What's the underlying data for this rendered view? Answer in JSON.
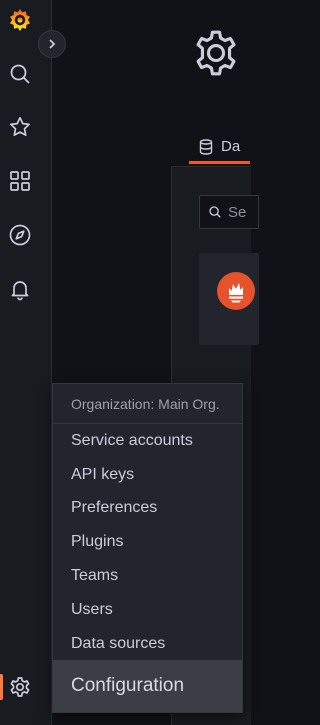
{
  "sidebar": {
    "logo_icon": "grafana-logo-icon",
    "expand_icon": "chevron-right-icon",
    "items": [
      {
        "name": "search",
        "icon": "search-icon"
      },
      {
        "name": "starred",
        "icon": "star-icon"
      },
      {
        "name": "dashboards",
        "icon": "apps-icon"
      },
      {
        "name": "explore",
        "icon": "compass-icon"
      },
      {
        "name": "alerting",
        "icon": "bell-icon"
      },
      {
        "name": "configuration",
        "icon": "gear-icon",
        "active": true
      }
    ],
    "accent_color": "#ff7941"
  },
  "page": {
    "header_icon": "gear-icon",
    "tab_label": "Da",
    "tab_icon": "database-icon",
    "search_placeholder": "Se",
    "card_icon": "prometheus-logo-icon"
  },
  "menu": {
    "header": "Organization: Main Org.",
    "items": [
      "Service accounts",
      "API keys",
      "Preferences",
      "Plugins",
      "Teams",
      "Users",
      "Data sources"
    ],
    "title": "Configuration"
  }
}
